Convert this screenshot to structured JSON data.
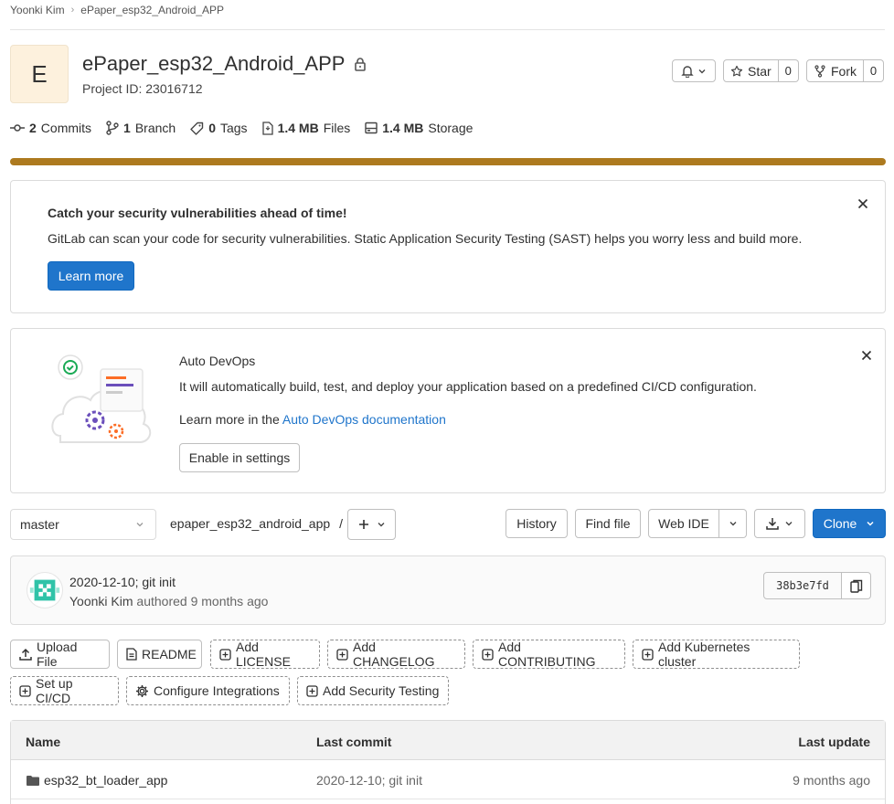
{
  "breadcrumb": {
    "user": "Yoonki Kim",
    "project": "ePaper_esp32_Android_APP"
  },
  "project": {
    "avatar_letter": "E",
    "name": "ePaper_esp32_Android_APP",
    "id_label": "Project ID: 23016712"
  },
  "actions": {
    "star_label": "Star",
    "star_count": "0",
    "fork_label": "Fork",
    "fork_count": "0"
  },
  "stats": {
    "commits_count": "2",
    "commits_label": "Commits",
    "branch_count": "1",
    "branch_label": "Branch",
    "tags_count": "0",
    "tags_label": "Tags",
    "files_size": "1.4 MB",
    "files_label": "Files",
    "storage_size": "1.4 MB",
    "storage_label": "Storage"
  },
  "storage_bar": {
    "fill_fraction": 1.0,
    "color": "#ad7a1f"
  },
  "sast_banner": {
    "title": "Catch your security vulnerabilities ahead of time!",
    "description": "GitLab can scan your code for security vulnerabilities. Static Application Security Testing (SAST) helps you worry less and build more.",
    "button": "Learn more"
  },
  "devops_banner": {
    "title": "Auto DevOps",
    "description": "It will automatically build, test, and deploy your application based on a predefined CI/CD configuration.",
    "more_prefix": "Learn more in the",
    "more_link": "Auto DevOps documentation",
    "button": "Enable in settings"
  },
  "repo_toolbar": {
    "branch": "master",
    "path": "epaper_esp32_android_app",
    "path_sep": "/",
    "history": "History",
    "find_file": "Find file",
    "web_ide": "Web IDE",
    "clone": "Clone"
  },
  "last_commit": {
    "title": "2020-12-10; git init",
    "author": "Yoonki Kim",
    "authored": "authored",
    "time": "9 months ago",
    "sha": "38b3e7fd"
  },
  "quick_actions": {
    "upload_file": "Upload File",
    "readme": "README",
    "add_license": "Add LICENSE",
    "add_changelog": "Add CHANGELOG",
    "add_contributing": "Add CONTRIBUTING",
    "add_kubernetes": "Add Kubernetes cluster",
    "setup_cicd": "Set up CI/CD",
    "configure_integrations": "Configure Integrations",
    "add_security_testing": "Add Security Testing"
  },
  "file_table": {
    "headers": {
      "name": "Name",
      "last_commit": "Last commit",
      "last_update": "Last update"
    },
    "rows": [
      {
        "name": "esp32_bt_loader_app",
        "commit": "2020-12-10; git init",
        "updated": "9 months ago",
        "type": "folder"
      }
    ]
  },
  "colors": {
    "primary_blue": "#1f75cb",
    "storage_bar": "#ad7a1f",
    "avatar_bg": "#fdf1dd"
  }
}
